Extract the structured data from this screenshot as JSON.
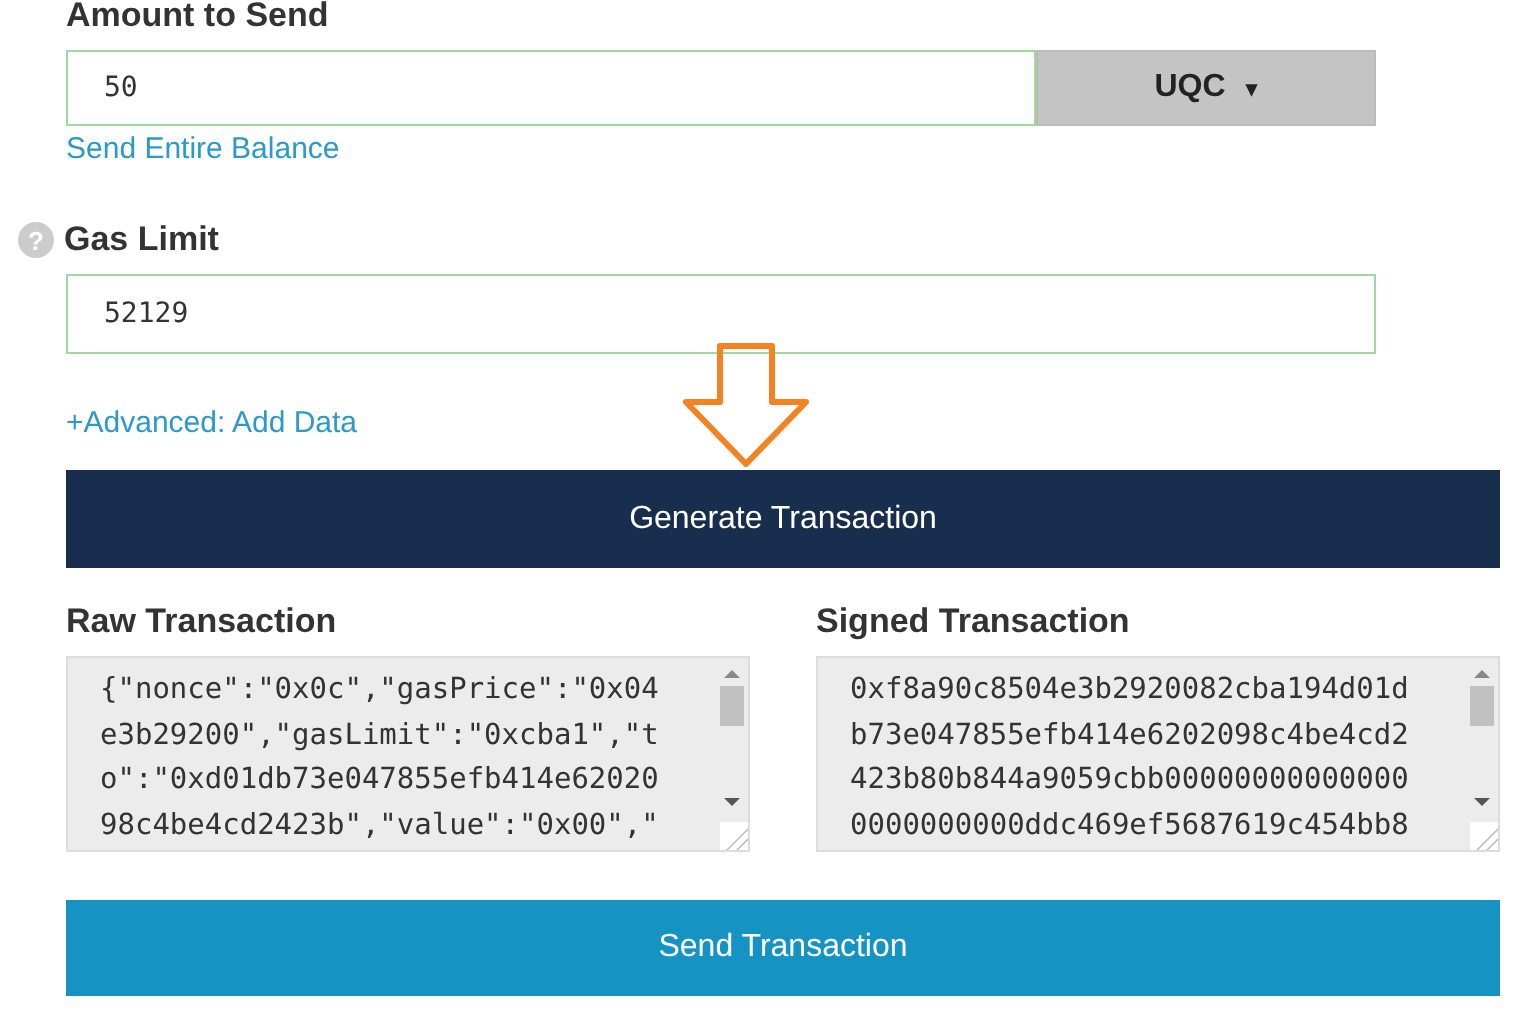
{
  "amount": {
    "label": "Amount to Send",
    "value": "50",
    "currency": "UQC",
    "caret": "▾",
    "link": "Send Entire Balance"
  },
  "gas": {
    "help": "?",
    "label": "Gas Limit",
    "value": "52129",
    "link": "+Advanced: Add Data"
  },
  "generate_button": "Generate Transaction",
  "raw": {
    "label": "Raw Transaction",
    "lines": [
      "{\"nonce\":\"0x0c\",\"gasPrice\":\"0x04",
      "e3b29200\",\"gasLimit\":\"0xcba1\",\"t",
      "o\":\"0xd01db73e047855efb414e62020",
      "98c4be4cd2423b\",\"value\":\"0x00\",\""
    ]
  },
  "signed": {
    "label": "Signed Transaction",
    "lines": [
      "0xf8a90c8504e3b2920082cba194d01d",
      "b73e047855efb414e6202098c4be4cd2",
      "423b80b844a9059cbb00000000000000",
      "0000000000ddc469ef5687619c454bb8"
    ]
  },
  "send_button": "Send Transaction"
}
